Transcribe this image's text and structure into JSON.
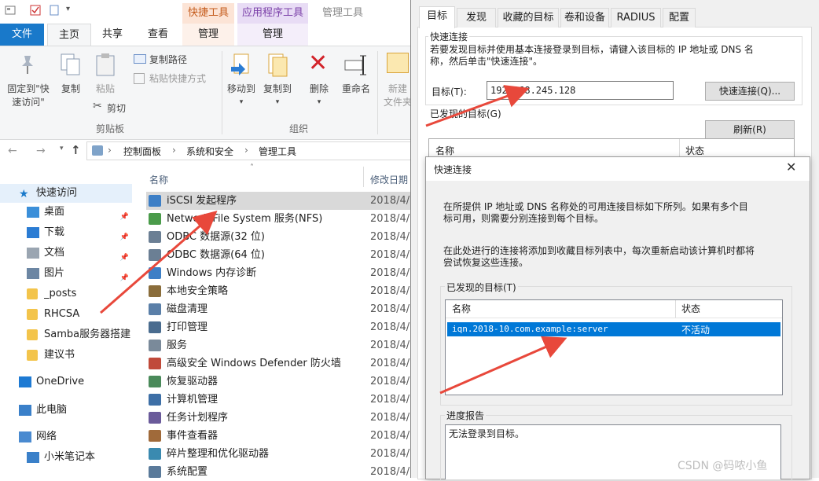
{
  "explorer": {
    "contextual_tabs": [
      "快捷工具",
      "应用程序工具",
      "管理工具"
    ],
    "ribbon_tabs": [
      "文件",
      "主页",
      "共享",
      "查看",
      "管理",
      "管理"
    ],
    "ribbon": {
      "pin_label_1": "固定到\"快",
      "pin_label_2": "速访问\"",
      "copy_label": "复制",
      "paste_label": "粘贴",
      "copy_path": "复制路径",
      "paste_shortcut": "粘贴快捷方式",
      "cut": "剪切",
      "clipboard_group": "剪贴板",
      "move_to": "移动到",
      "copy_to": "复制到",
      "delete": "删除",
      "rename": "重命名",
      "new_1": "新建",
      "new_2": "文件夹",
      "organize_group": "组织"
    },
    "breadcrumb": [
      "控制面板",
      "系统和安全",
      "管理工具"
    ],
    "nav": [
      {
        "label": "快速访问",
        "icon": "star-icon",
        "pinned": false
      },
      {
        "label": "桌面",
        "icon": "desktop-icon",
        "pinned": true
      },
      {
        "label": "下载",
        "icon": "download-icon",
        "pinned": true
      },
      {
        "label": "文档",
        "icon": "document-icon",
        "pinned": true
      },
      {
        "label": "图片",
        "icon": "picture-icon",
        "pinned": true
      },
      {
        "label": "_posts",
        "icon": "folder-icon",
        "pinned": false
      },
      {
        "label": "RHCSA",
        "icon": "folder-icon",
        "pinned": false
      },
      {
        "label": "Samba服务器搭建",
        "icon": "folder-icon",
        "pinned": false
      },
      {
        "label": "建议书",
        "icon": "folder-icon",
        "pinned": false
      },
      {
        "label": "OneDrive",
        "icon": "cloud-icon",
        "pinned": false
      },
      {
        "label": "此电脑",
        "icon": "computer-icon",
        "pinned": false
      },
      {
        "label": "网络",
        "icon": "network-icon",
        "pinned": false
      },
      {
        "label": "小米笔记本",
        "icon": "computer-icon",
        "pinned": false
      }
    ],
    "columns": {
      "name": "名称",
      "modified": "修改日期"
    },
    "files": [
      {
        "name": "iSCSI 发起程序",
        "date": "2018/4/"
      },
      {
        "name": "Network File System 服务(NFS)",
        "date": "2018/4/"
      },
      {
        "name": "ODBC 数据源(32 位)",
        "date": "2018/4/"
      },
      {
        "name": "ODBC 数据源(64 位)",
        "date": "2018/4/"
      },
      {
        "name": "Windows 内存诊断",
        "date": "2018/4/"
      },
      {
        "name": "本地安全策略",
        "date": "2018/4/"
      },
      {
        "name": "磁盘清理",
        "date": "2018/4/"
      },
      {
        "name": "打印管理",
        "date": "2018/4/"
      },
      {
        "name": "服务",
        "date": "2018/4/"
      },
      {
        "name": "高级安全 Windows Defender 防火墙",
        "date": "2018/4/"
      },
      {
        "name": "恢复驱动器",
        "date": "2018/4/"
      },
      {
        "name": "计算机管理",
        "date": "2018/4/"
      },
      {
        "name": "任务计划程序",
        "date": "2018/4/"
      },
      {
        "name": "事件查看器",
        "date": "2018/4/"
      },
      {
        "name": "碎片整理和优化驱动器",
        "date": "2018/4/"
      },
      {
        "name": "系统配置",
        "date": "2018/4/"
      }
    ]
  },
  "props": {
    "tabs": [
      "目标",
      "发现",
      "收藏的目标",
      "卷和设备",
      "RADIUS",
      "配置"
    ],
    "quick_connect_title": "快速连接",
    "quick_connect_desc_1": "若要发现目标并使用基本连接登录到目标，请键入该目标的 IP 地址或 DNS 名",
    "quick_connect_desc_2": "称，然后单击\"快速连接\"。",
    "target_label": "目标(T):",
    "target_value": "192.168.245.128",
    "quick_connect_button": "快速连接(Q)...",
    "discovered_title": "已发现的目标(G)",
    "refresh_button": "刷新(R)",
    "col_name": "名称",
    "col_status": "状态"
  },
  "dialog": {
    "title": "快速连接",
    "desc1_line1": "在所提供 IP 地址或 DNS 名称处的可用连接目标如下所列。如果有多个目",
    "desc1_line2": "标可用，则需要分别连接到每个目标。",
    "desc2_line1": "在此处进行的连接将添加到收藏目标列表中，每次重新启动该计算机时都将",
    "desc2_line2": "尝试恢复这些连接。",
    "discovered_label": "已发现的目标(T)",
    "col_name": "名称",
    "col_status": "状态",
    "target_row": {
      "name": "iqn.2018-10.com.example:server",
      "status": "不活动"
    },
    "progress_label": "进度报告",
    "progress_text": "无法登录到目标。"
  },
  "watermark": "CSDN @码哝小鱼",
  "colors": {
    "accent": "#1979ca",
    "selection": "#0078d7",
    "arrow": "#e8483b",
    "ctx_orange": "#fce4d6",
    "ctx_purple": "#e8dcf5"
  }
}
